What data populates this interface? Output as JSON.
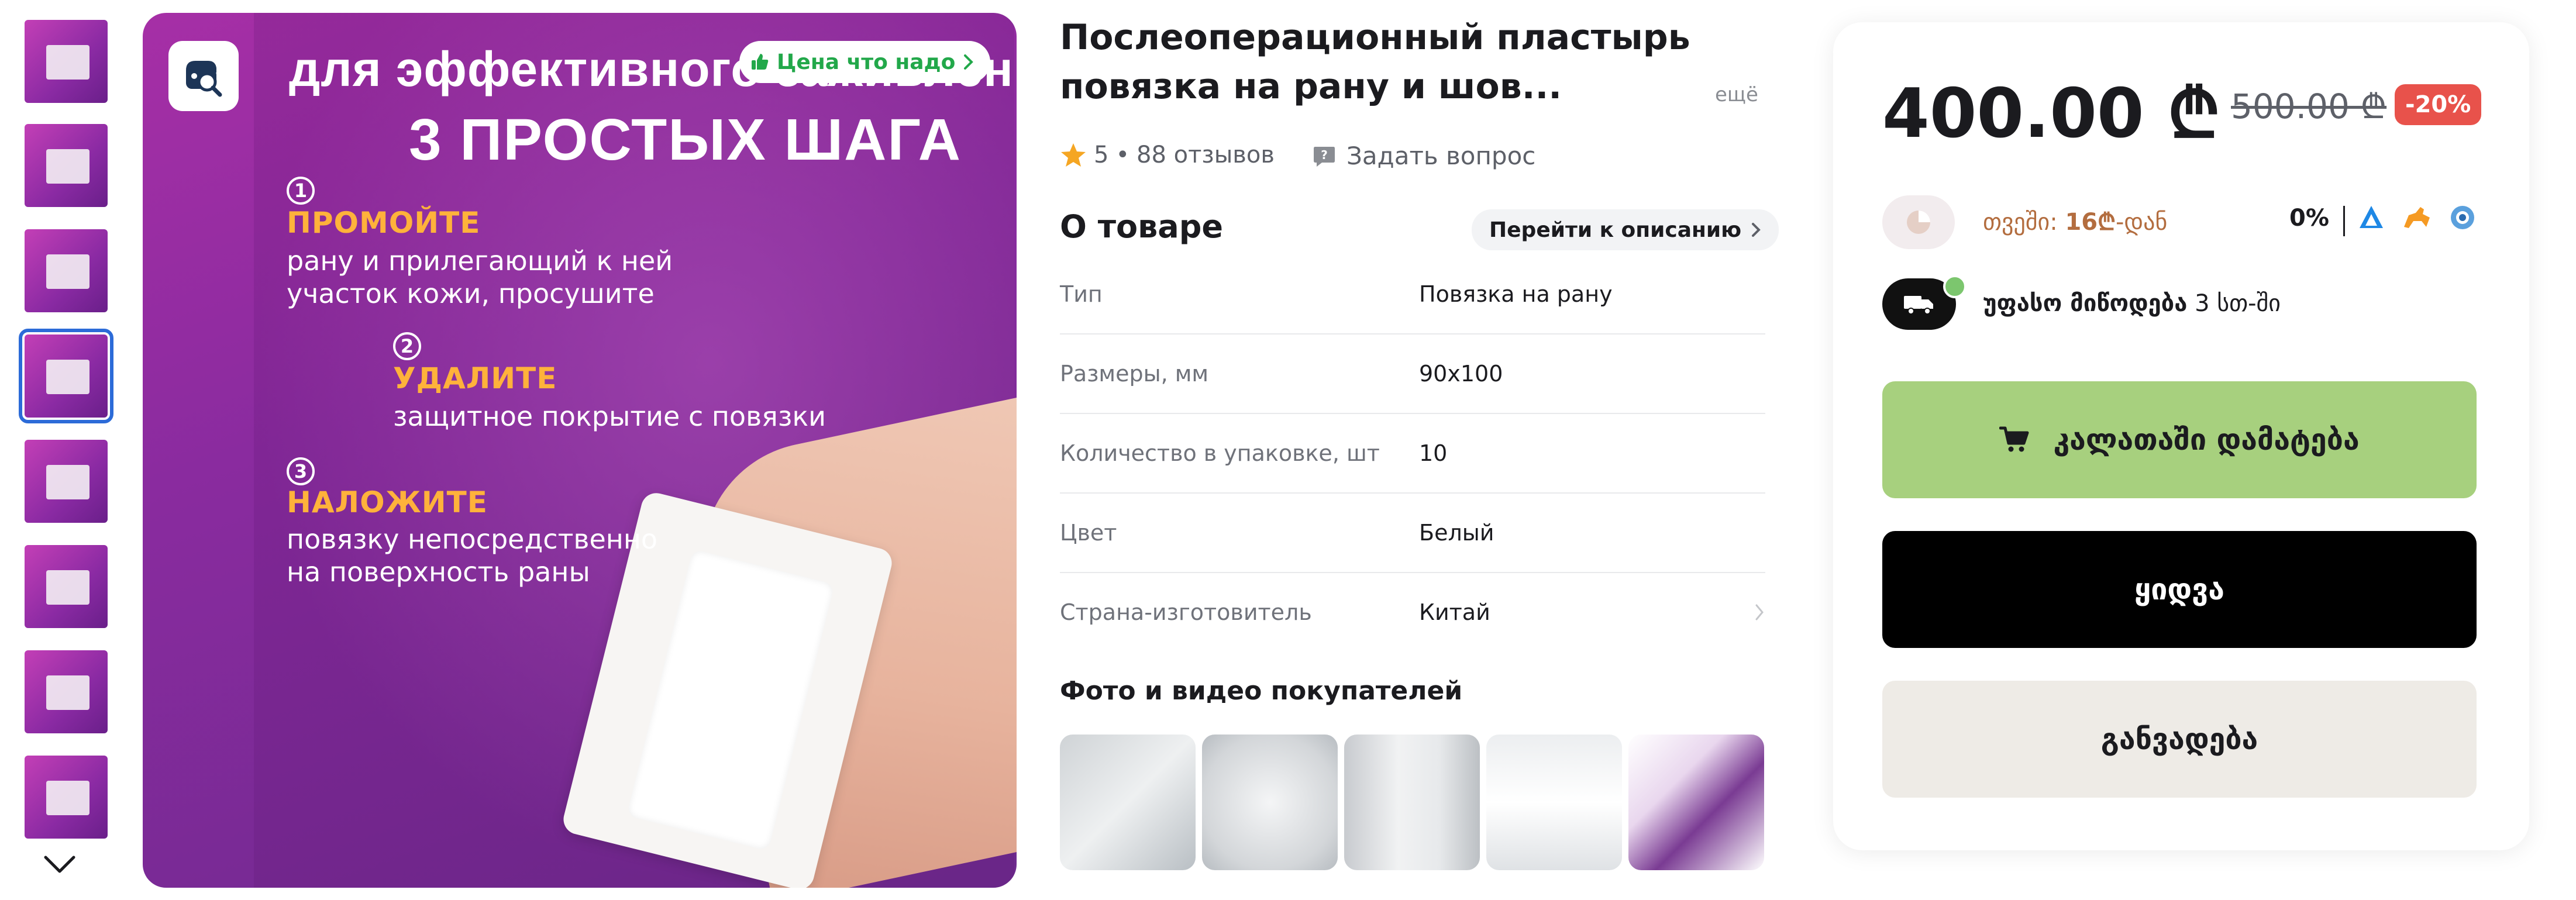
{
  "gallery": {
    "thumbnail_count": 8,
    "selected_index": 3
  },
  "main_image": {
    "headline_line1": "для эффективного заживления",
    "headline_line2": "3 ПРОСТЫХ ШАГА",
    "badge": "Цена что надо",
    "steps": [
      {
        "num": "1",
        "head": "ПРОМОЙТЕ",
        "body1": "рану и прилегающий к ней",
        "body2": "участок кожи, просушите"
      },
      {
        "num": "2",
        "head": "УДАЛИТЕ",
        "body1": "защитное покрытие с повязки",
        "body2": ""
      },
      {
        "num": "3",
        "head": "НАЛОЖИТЕ",
        "body1": "повязку непосредственно",
        "body2": "на поверхность раны"
      }
    ]
  },
  "product": {
    "title": "Послеоперационный пластырь повязка на рану и шов...",
    "more": "ещё",
    "rating": "5",
    "dot": "•",
    "reviews": "88 отзывов",
    "ask": "Задать вопрос"
  },
  "about": {
    "title": "О товаре",
    "go_to_description": "Перейти к описанию",
    "specs": [
      {
        "key": "Тип",
        "value": "Повязка на рану"
      },
      {
        "key": "Размеры, мм",
        "value": "90x100"
      },
      {
        "key": "Количество в упаковке, шт",
        "value": "10"
      },
      {
        "key": "Цвет",
        "value": "Белый"
      },
      {
        "key": "Страна-изготовитель",
        "value": "Китай"
      }
    ]
  },
  "customer_media": {
    "title": "Фото и видео покупателей",
    "count": 5
  },
  "buy_panel": {
    "price": "400.00 ₾",
    "old_price": "500.00 ₾",
    "discount": "-20%",
    "installment_prefix": "თვეში: ",
    "installment_amount": "16₾",
    "installment_suffix": "-დან",
    "installment_percent": "0%",
    "delivery_bold": "უფასო მიწოდება",
    "delivery_rest": " 3 სთ-ში",
    "add_to_cart": "კალათაში დამატება",
    "buy": "ყიდვა",
    "installments": "განვადება"
  },
  "colors": {
    "accent_green": "#a7d07e",
    "discount_red": "#e8524b",
    "selected_blue": "#2c6bd8",
    "star": "#f5a623"
  }
}
